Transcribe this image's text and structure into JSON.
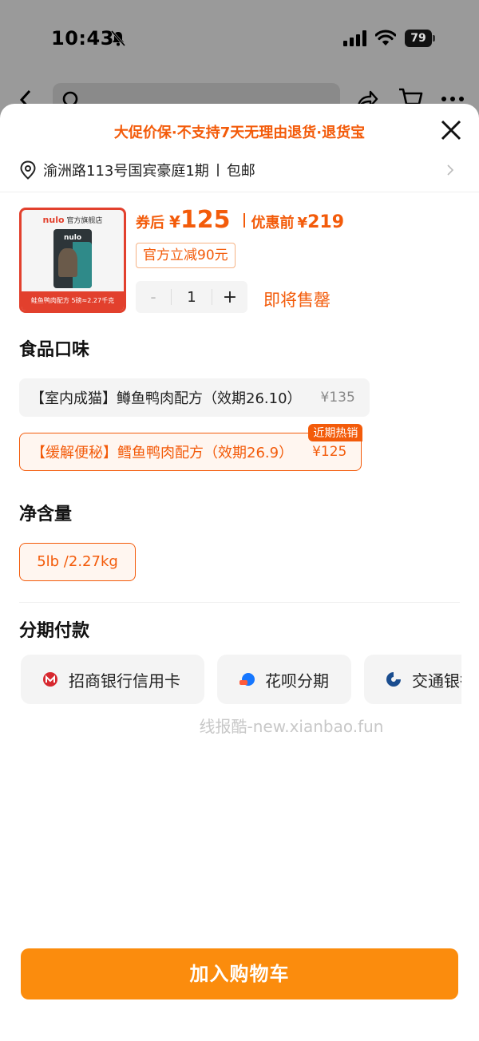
{
  "status_bar": {
    "time": "10:43",
    "battery": "79"
  },
  "sheet": {
    "promo_notice": "大促价保·不支持7天无理由退货·退货宝",
    "address": {
      "text": "渝洲路113号国宾豪庭1期",
      "shipping": "包邮"
    },
    "product": {
      "thumb_brand": "nulo",
      "thumb_store": "官方旗舰店",
      "thumb_caption": "鲑鱼鸭肉配方 5磅≈2.27千克",
      "price_after_label": "券后",
      "currency": "¥",
      "price_after": "125",
      "price_before_label": "优惠前",
      "price_before": "219",
      "discount_tag": "官方立减90元",
      "quantity": "1",
      "minus": "-",
      "plus": "+",
      "stock_status": "即将售罄"
    },
    "flavor": {
      "title": "食品口味",
      "options": [
        {
          "label": "【室内成猫】鳟鱼鸭肉配方（效期26.10）",
          "price": "¥135",
          "selected": false
        },
        {
          "label": "【缓解便秘】鳕鱼鸭肉配方（效期26.9）",
          "price": "¥125",
          "selected": true,
          "badge": "近期热销"
        }
      ]
    },
    "weight": {
      "title": "净含量",
      "options": [
        "5lb /2.27kg"
      ]
    },
    "installment": {
      "title": "分期付款",
      "options": [
        {
          "label": "招商银行信用卡",
          "icon": "cmb-bank-icon"
        },
        {
          "label": "花呗分期",
          "icon": "huabei-icon"
        },
        {
          "label": "交通银行",
          "icon": "bocom-bank-icon"
        }
      ]
    },
    "watermark": "线报酷-new.xianbao.fun",
    "add_to_cart": "加入购物车"
  },
  "colors": {
    "accent": "#f35b0a",
    "button": "#fb8c0d",
    "thumb_border": "#e2402d"
  }
}
